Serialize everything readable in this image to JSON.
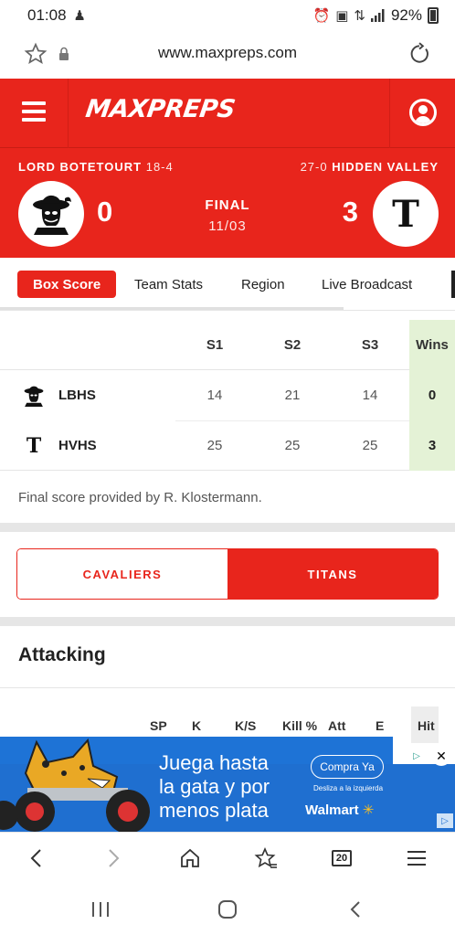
{
  "status_bar": {
    "time": "01:08",
    "battery": "92%"
  },
  "browser": {
    "url": "www.maxpreps.com"
  },
  "header": {
    "logo_prefix": "MA",
    "logo_x": "X",
    "logo_suffix": "PREPS"
  },
  "game": {
    "home": {
      "name": "LORD BOTETOURT",
      "record": "18-4",
      "score": "0",
      "abbr": "LBHS"
    },
    "away": {
      "name": "HIDDEN VALLEY",
      "record": "27-0",
      "score": "3",
      "abbr": "HVHS",
      "logo_letter": "T"
    },
    "status": "FINAL",
    "date": "11/03"
  },
  "tabs": [
    "Box Score",
    "Team Stats",
    "Region",
    "Live Broadcast"
  ],
  "box_score": {
    "headers": [
      "S1",
      "S2",
      "S3",
      "Wins"
    ],
    "rows": [
      {
        "team": "LBHS",
        "s1": "14",
        "s2": "21",
        "s3": "14",
        "wins": "0"
      },
      {
        "team": "HVHS",
        "s1": "25",
        "s2": "25",
        "s3": "25",
        "wins": "3"
      }
    ],
    "credit": "Final score provided by R. Klostermann."
  },
  "team_toggle": {
    "left": "CAVALIERS",
    "right": "TITANS",
    "selected": "TITANS"
  },
  "attacking": {
    "title": "Attacking",
    "columns": [
      "SP",
      "K",
      "K/S",
      "Kill %",
      "Att",
      "E",
      "Hit"
    ]
  },
  "ad": {
    "line1": "Juega hasta",
    "line2": "la gata y por",
    "line3": "menos plata",
    "cta": "Compra Ya",
    "sub": "Desliza a la izquierda",
    "brand": "Walmart",
    "close": "✕"
  },
  "browser_nav": {
    "tab_count": "20"
  },
  "colors": {
    "brand_red": "#e8251c",
    "wins_bg": "#e4f2d6",
    "ad_blue": "#1f6fd0"
  }
}
